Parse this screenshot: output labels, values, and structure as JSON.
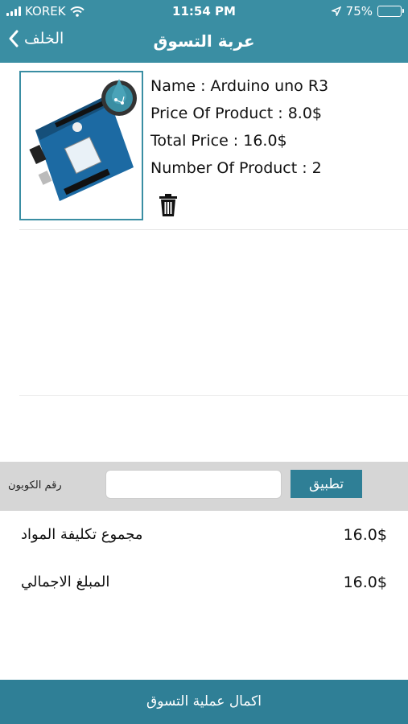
{
  "status_bar": {
    "carrier": "KOREK",
    "time": "11:54 PM",
    "battery": "75%",
    "battery_level": 0.75
  },
  "nav": {
    "back_label": "الخلف",
    "title": "عربة التسوق"
  },
  "cart_items": [
    {
      "name_line": "Name : Arduino uno R3",
      "price_line": "Price Of Product : 8.0$",
      "total_line": "Total Price : 16.0$",
      "count_line": "Number Of Product : 2"
    }
  ],
  "coupon": {
    "label": "رقم الكوبون",
    "value": "",
    "placeholder": "",
    "apply_label": "تطبيق"
  },
  "summary": {
    "materials_label": "مجموع تكليفة المواد",
    "materials_value": "16.0$",
    "total_label": "المبلغ الاجمالي",
    "total_value": "16.0$"
  },
  "checkout_label": "اكمال عملية التسوق",
  "colors": {
    "primary": "#3a8ea3",
    "button": "#2f7f96",
    "coupon_bar": "#d6d6d6"
  },
  "icons": [
    "signal-icon",
    "wifi-icon",
    "location-arrow-icon",
    "battery-icon",
    "chevron-left-icon",
    "trash-icon"
  ]
}
